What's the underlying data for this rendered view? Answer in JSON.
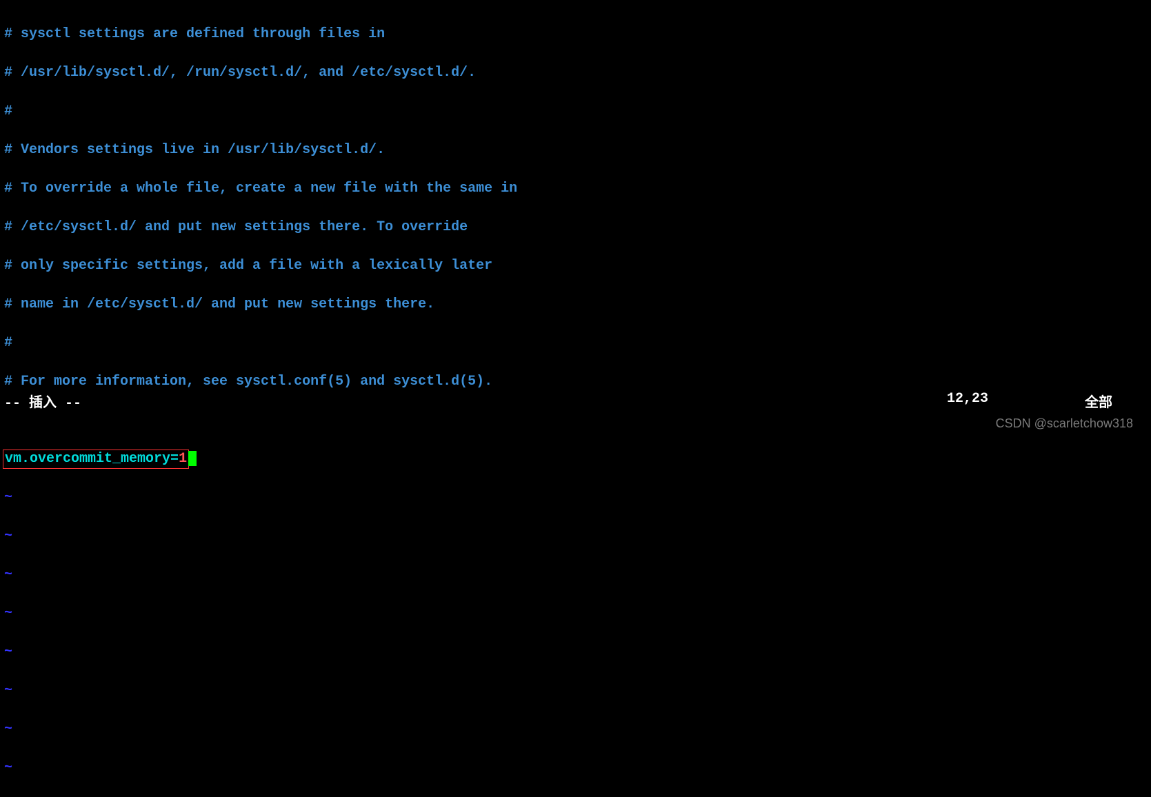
{
  "comments": [
    "# sysctl settings are defined through files in",
    "# /usr/lib/sysctl.d/, /run/sysctl.d/, and /etc/sysctl.d/.",
    "#",
    "# Vendors settings live in /usr/lib/sysctl.d/.",
    "# To override a whole file, create a new file with the same in",
    "# /etc/sysctl.d/ and put new settings there. To override",
    "# only specific settings, add a file with a lexically later",
    "# name in /etc/sysctl.d/ and put new settings there.",
    "#",
    "# For more information, see sysctl.conf(5) and sysctl.d(5)."
  ],
  "setting": {
    "key": "vm.overcommit_memory",
    "equals": "=",
    "value": "1"
  },
  "tilde": "~",
  "status": {
    "mode": "-- 插入 --",
    "position": "12,23",
    "percent": "全部"
  },
  "watermark": "CSDN @scarletchow318"
}
